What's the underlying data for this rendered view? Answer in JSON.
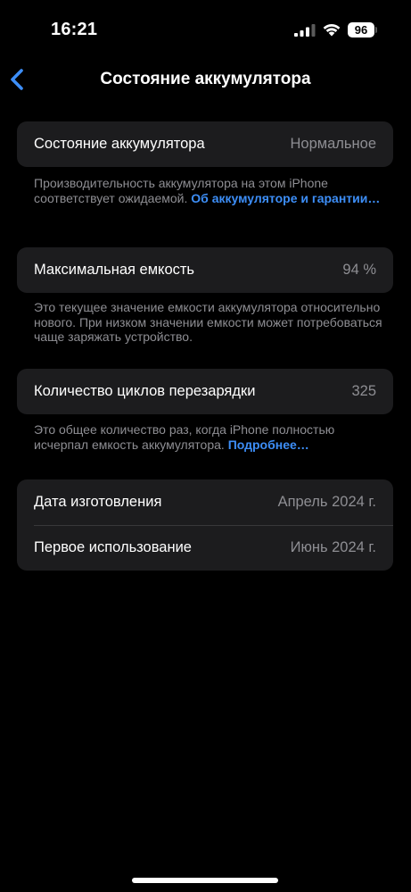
{
  "status_bar": {
    "time": "16:21",
    "battery_level": "96"
  },
  "nav": {
    "title": "Состояние аккумулятора"
  },
  "battery_health": {
    "label": "Состояние аккумулятора",
    "value": "Нормальное",
    "footnote_text": "Производительность аккумулятора на этом iPhone соответствует ожидаемой. ",
    "footnote_link": "Об аккумуляторе и гарантии…"
  },
  "max_capacity": {
    "label": "Максимальная емкость",
    "value": "94 %",
    "footnote_text": "Это текущее значение емкости аккумулятора относительно нового. При низком значении емкости может потребоваться чаще заряжать устройство."
  },
  "cycle_count": {
    "label": "Количество циклов перезарядки",
    "value": "325",
    "footnote_text": "Это общее количество раз, когда iPhone полностью исчерпал емкость аккумулятора. ",
    "footnote_link": "Подробнее…"
  },
  "dates": {
    "manufacture_label": "Дата изготовления",
    "manufacture_value": "Апрель 2024 г.",
    "first_use_label": "Первое использование",
    "first_use_value": "Июнь 2024 г."
  },
  "colors": {
    "accent": "#3d8ef7",
    "background": "#000000",
    "group_background": "#1c1c1e",
    "secondary_text": "#8e8e93"
  }
}
